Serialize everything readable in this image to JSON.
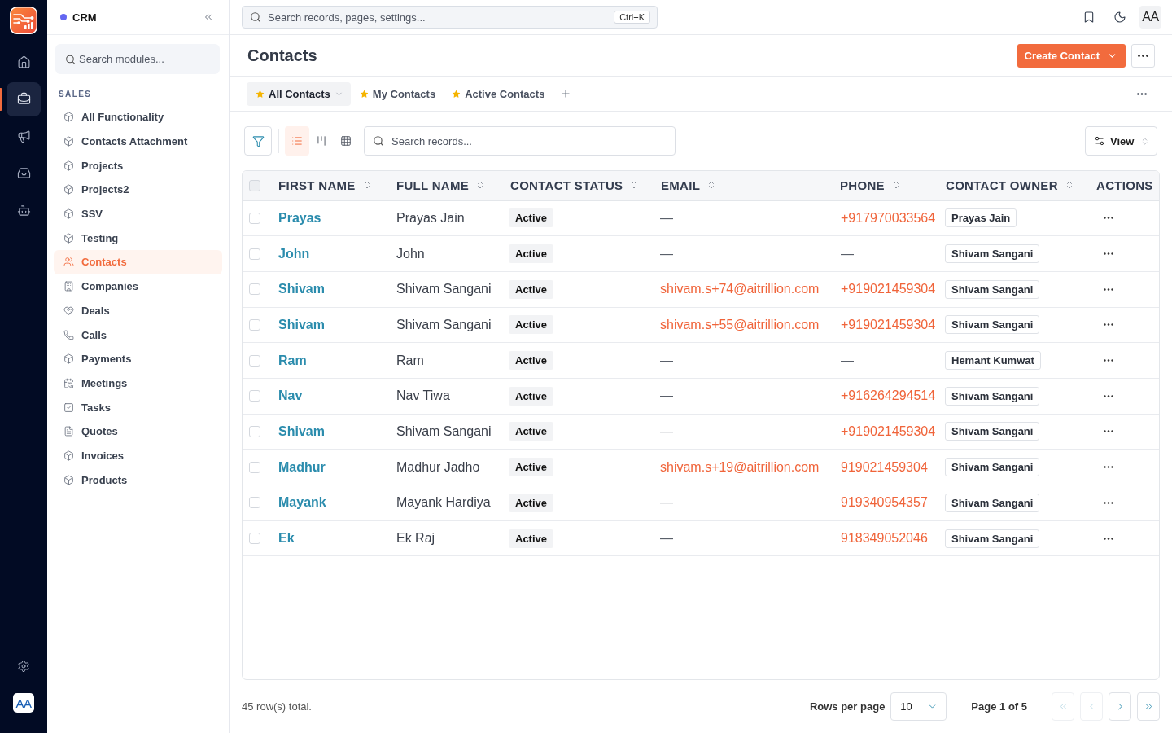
{
  "rail": {
    "items": [
      {
        "kind": "home",
        "selected": false
      },
      {
        "kind": "briefcase",
        "selected": true
      },
      {
        "kind": "megaphone",
        "selected": false
      },
      {
        "kind": "inbox",
        "selected": false
      },
      {
        "kind": "bot",
        "selected": false
      }
    ],
    "avatar": "AA"
  },
  "sidebar": {
    "title": "CRM",
    "search": {
      "placeholder": "Search modules..."
    },
    "section": "SALES",
    "items": [
      {
        "label": "All Functionality",
        "kind": "cube",
        "selected": false
      },
      {
        "label": "Contacts Attachment",
        "kind": "cube",
        "selected": false
      },
      {
        "label": "Projects",
        "kind": "cube",
        "selected": false
      },
      {
        "label": "Projects2",
        "kind": "cube",
        "selected": false
      },
      {
        "label": "SSV",
        "kind": "cube",
        "selected": false
      },
      {
        "label": "Testing",
        "kind": "cube",
        "selected": false
      },
      {
        "label": "Contacts",
        "kind": "users",
        "selected": true
      },
      {
        "label": "Companies",
        "kind": "building",
        "selected": false
      },
      {
        "label": "Deals",
        "kind": "handshake",
        "selected": false
      },
      {
        "label": "Calls",
        "kind": "phone",
        "selected": false
      },
      {
        "label": "Payments",
        "kind": "cube",
        "selected": false
      },
      {
        "label": "Meetings",
        "kind": "calendar",
        "selected": false
      },
      {
        "label": "Tasks",
        "kind": "check",
        "selected": false
      },
      {
        "label": "Quotes",
        "kind": "file",
        "selected": false
      },
      {
        "label": "Invoices",
        "kind": "cube",
        "selected": false
      },
      {
        "label": "Products",
        "kind": "cube",
        "selected": false
      }
    ]
  },
  "topbar": {
    "search": {
      "placeholder": "Search records, pages, settings..."
    },
    "shortcut": "Ctrl+K",
    "avatar": "AA"
  },
  "header": {
    "title": "Contacts",
    "primary_button": "Create Contact"
  },
  "views": [
    {
      "label": "All Contacts",
      "selected": true
    },
    {
      "label": "My Contacts",
      "selected": false
    },
    {
      "label": "Active Contacts",
      "selected": false
    }
  ],
  "toolbar": {
    "view_modes": [
      {
        "kind": "list",
        "selected": true
      },
      {
        "kind": "kanban",
        "selected": false
      },
      {
        "kind": "grid",
        "selected": false
      }
    ],
    "search": {
      "placeholder": "Search records..."
    },
    "view_button": "View"
  },
  "table": {
    "select_all": {
      "checked": false
    },
    "columns": [
      {
        "label": "FIRST NAME",
        "sortable": true
      },
      {
        "label": "FULL NAME",
        "sortable": true
      },
      {
        "label": "CONTACT STATUS",
        "sortable": true
      },
      {
        "label": "EMAIL",
        "sortable": true
      },
      {
        "label": "PHONE",
        "sortable": true
      },
      {
        "label": "CONTACT OWNER",
        "sortable": true
      },
      {
        "label": "ACTIONS",
        "sortable": false
      }
    ],
    "rows": [
      {
        "checked": false,
        "first_name": "Prayas",
        "full_name": "Prayas Jain",
        "status": "Active",
        "email": {
          "text": "—",
          "kind": "empty"
        },
        "phone": {
          "text": "+917970033564",
          "kind": "link"
        },
        "owner": "Prayas Jain"
      },
      {
        "checked": false,
        "first_name": "John",
        "full_name": "John",
        "status": "Active",
        "email": {
          "text": "—",
          "kind": "empty"
        },
        "phone": {
          "text": "—",
          "kind": "empty"
        },
        "owner": "Shivam Sangani"
      },
      {
        "checked": false,
        "first_name": "Shivam",
        "full_name": "Shivam Sangani",
        "status": "Active",
        "email": {
          "text": "shivam.s+74@aitrillion.com",
          "kind": "link"
        },
        "phone": {
          "text": "+919021459304",
          "kind": "link"
        },
        "owner": "Shivam Sangani"
      },
      {
        "checked": false,
        "first_name": "Shivam",
        "full_name": "Shivam Sangani",
        "status": "Active",
        "email": {
          "text": "shivam.s+55@aitrillion.com",
          "kind": "link"
        },
        "phone": {
          "text": "+919021459304",
          "kind": "link"
        },
        "owner": "Shivam Sangani"
      },
      {
        "checked": false,
        "first_name": "Ram",
        "full_name": "Ram",
        "status": "Active",
        "email": {
          "text": "—",
          "kind": "empty"
        },
        "phone": {
          "text": "—",
          "kind": "empty"
        },
        "owner": "Hemant Kumwat"
      },
      {
        "checked": false,
        "first_name": "Nav",
        "full_name": "Nav Tiwa",
        "status": "Active",
        "email": {
          "text": "—",
          "kind": "empty"
        },
        "phone": {
          "text": "+916264294514",
          "kind": "link"
        },
        "owner": "Shivam Sangani"
      },
      {
        "checked": false,
        "first_name": "Shivam",
        "full_name": "Shivam Sangani",
        "status": "Active",
        "email": {
          "text": "—",
          "kind": "empty"
        },
        "phone": {
          "text": "+919021459304",
          "kind": "link"
        },
        "owner": "Shivam Sangani"
      },
      {
        "checked": false,
        "first_name": "Madhur",
        "full_name": "Madhur Jadho",
        "status": "Active",
        "email": {
          "text": "shivam.s+19@aitrillion.com",
          "kind": "link"
        },
        "phone": {
          "text": "919021459304",
          "kind": "link"
        },
        "owner": "Shivam Sangani"
      },
      {
        "checked": false,
        "first_name": "Mayank",
        "full_name": "Mayank Hardiya",
        "status": "Active",
        "email": {
          "text": "—",
          "kind": "empty"
        },
        "phone": {
          "text": "919340954357",
          "kind": "link"
        },
        "owner": "Shivam Sangani"
      },
      {
        "checked": false,
        "first_name": "Ek",
        "full_name": "Ek Raj",
        "status": "Active",
        "email": {
          "text": "—",
          "kind": "empty"
        },
        "phone": {
          "text": "918349052046",
          "kind": "link"
        },
        "owner": "Shivam Sangani"
      }
    ]
  },
  "footer": {
    "total": "45 row(s) total.",
    "rows_per_page_label": "Rows per page",
    "rows_per_page": "10",
    "page": "Page 1 of 5",
    "pagination": [
      {
        "kind": "first",
        "disabled": true
      },
      {
        "kind": "prev",
        "disabled": true
      },
      {
        "kind": "next",
        "disabled": false
      },
      {
        "kind": "last",
        "disabled": false
      }
    ]
  }
}
